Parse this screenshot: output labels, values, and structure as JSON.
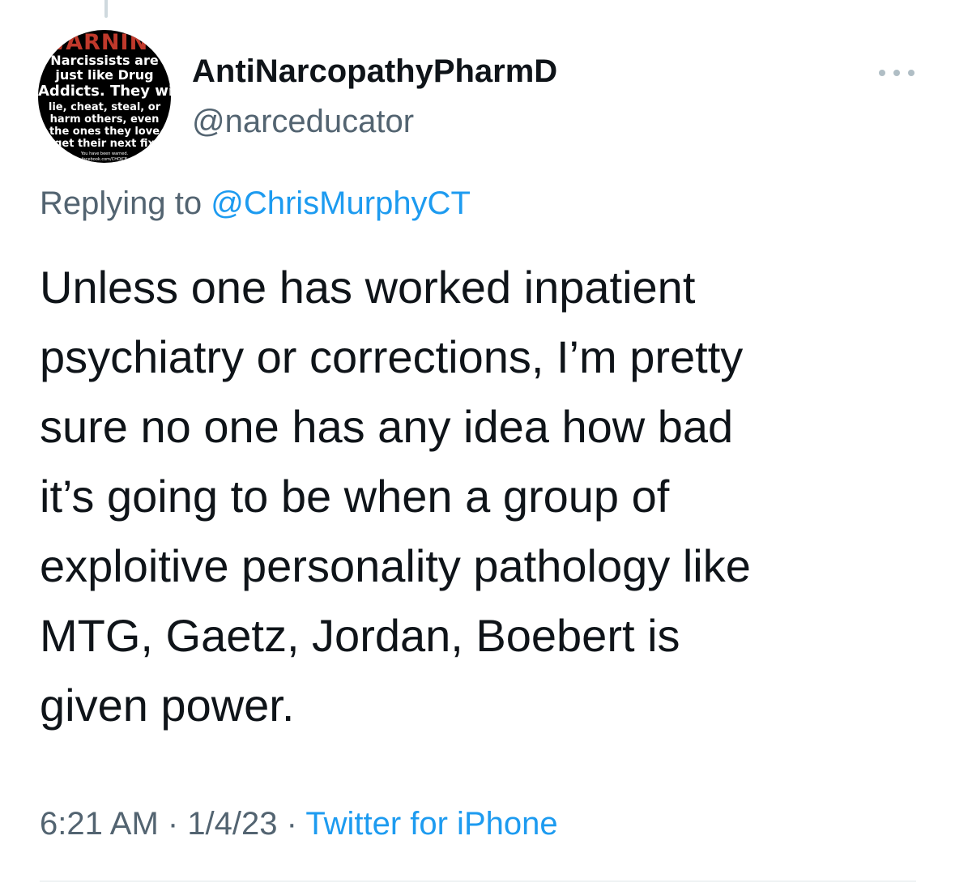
{
  "avatar": {
    "lines": [
      "WARNING",
      "Narcissists are",
      "just like Drug",
      "Addicts. They will",
      "lie, cheat, steal, or",
      "harm others, even",
      "the ones they love",
      "get their next fix",
      "You have been warned.",
      "facebook.com/CHOICE"
    ]
  },
  "author": {
    "display_name": "AntiNarcopathyPharmD",
    "handle": "@narceducator"
  },
  "reply": {
    "prefix": "Replying to ",
    "mention": "@ChrisMurphyCT"
  },
  "tweet": {
    "lines": [
      "Unless one has worked inpatient",
      "psychiatry or corrections, I’m pretty",
      "sure no one has any idea how bad",
      "it’s going to be when a group of",
      "exploitive personality pathology like",
      "MTG, Gaetz, Jordan, Boebert is",
      "given power."
    ]
  },
  "meta": {
    "time": "6:21 AM",
    "separator": " · ",
    "date": "1/4/23",
    "source": "Twitter for iPhone"
  },
  "icons": {
    "more": "more-horizontal-icon"
  },
  "colors": {
    "text": "#0f1419",
    "secondary": "#536471",
    "link": "#1d9bf0",
    "divider": "#eff3f4"
  }
}
